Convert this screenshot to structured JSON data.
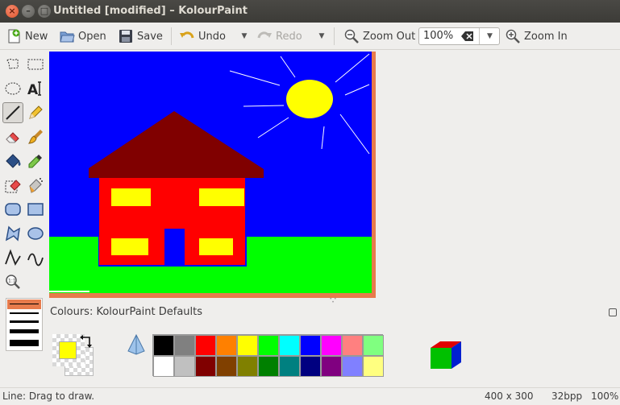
{
  "window": {
    "title": "Untitled [modified] – KolourPaint"
  },
  "toolbar": {
    "new_label": "New",
    "open_label": "Open",
    "save_label": "Save",
    "undo_label": "Undo",
    "redo_label": "Redo",
    "zoom_out_label": "Zoom Out",
    "zoom_value": "100%",
    "zoom_in_label": "Zoom In"
  },
  "tools": [
    "free-form-selection",
    "rectangular-selection",
    "elliptical-selection",
    "text",
    "line",
    "pen",
    "eraser",
    "brush",
    "flood-fill",
    "colour-picker",
    "colour-eraser",
    "spraycan",
    "rounded-rectangle",
    "rectangle",
    "polygon",
    "ellipse",
    "connected-lines",
    "curve",
    "zoom"
  ],
  "active_tool": "line",
  "colours": {
    "label_prefix": "Colours: ",
    "palette_name": "KolourPaint Defaults",
    "foreground": "#ffff00",
    "palette_row1": [
      "#000000",
      "#808080",
      "#ff0000",
      "#ff8000",
      "#ffff00",
      "#00ff00",
      "#00ffff",
      "#0000ff",
      "#ff00ff",
      "#ff8080",
      "#80ff80"
    ],
    "palette_row2": [
      "#ffffff",
      "#c0c0c0",
      "#800000",
      "#804000",
      "#808000",
      "#008000",
      "#008080",
      "#000080",
      "#800080",
      "#8080ff",
      "#ffff80"
    ]
  },
  "status": {
    "message": "Line: Drag to draw.",
    "image_size": "400 x 300",
    "bpp": "32bpp",
    "zoom": "100%"
  },
  "accent_color": "#e77b4c"
}
